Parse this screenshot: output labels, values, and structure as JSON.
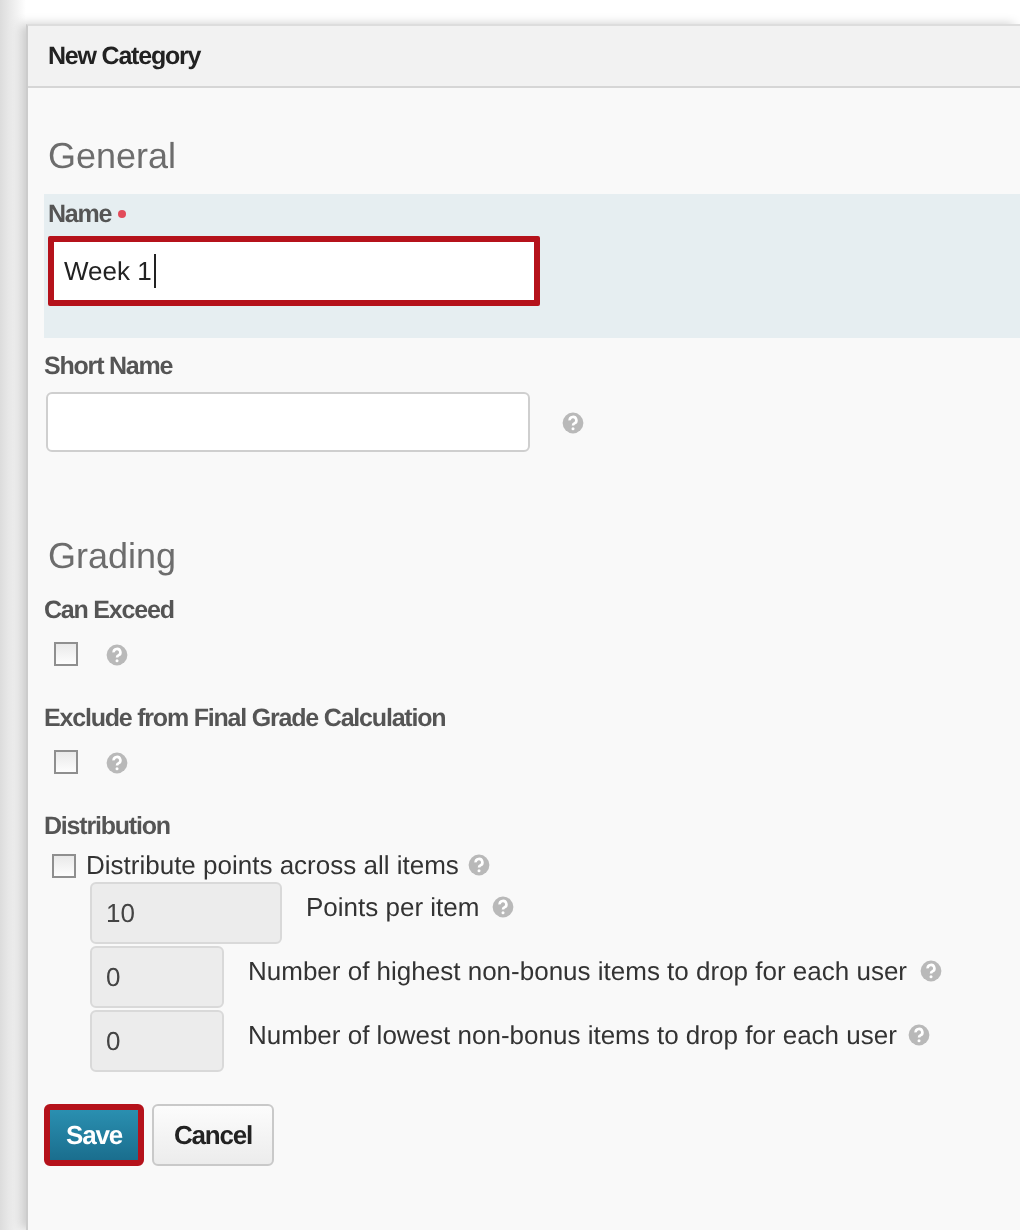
{
  "dialog": {
    "title": "New Category"
  },
  "general": {
    "heading": "General",
    "name": {
      "label": "Name",
      "required": true,
      "value": "Week 1",
      "focused": true,
      "highlighted": true
    },
    "short_name": {
      "label": "Short Name",
      "help": true
    }
  },
  "grading": {
    "heading": "Grading",
    "options": [
      {
        "label": "Can Exceed",
        "checked": false,
        "help": true
      },
      {
        "label": "Exclude from Final Grade Calculation",
        "checked": false,
        "help": true
      }
    ],
    "distribution": {
      "label": "Distribution",
      "toggle": {
        "label": "Distribute points across all items",
        "checked": false,
        "help": true
      },
      "inputs": [
        {
          "value": "10",
          "label": "Points per item",
          "disabled": true,
          "wide": true,
          "help": true
        },
        {
          "value": "0",
          "label": "Number of highest non-bonus items to drop for each user",
          "disabled": true,
          "wide": false,
          "help": true
        },
        {
          "value": "0",
          "label": "Number of lowest non-bonus items to drop for each user",
          "disabled": true,
          "wide": false,
          "help": true
        }
      ]
    }
  },
  "buttons": [
    {
      "label": "Save",
      "kind": "primary",
      "highlighted": true
    },
    {
      "label": "Cancel",
      "kind": "secondary",
      "highlighted": false
    }
  ]
}
